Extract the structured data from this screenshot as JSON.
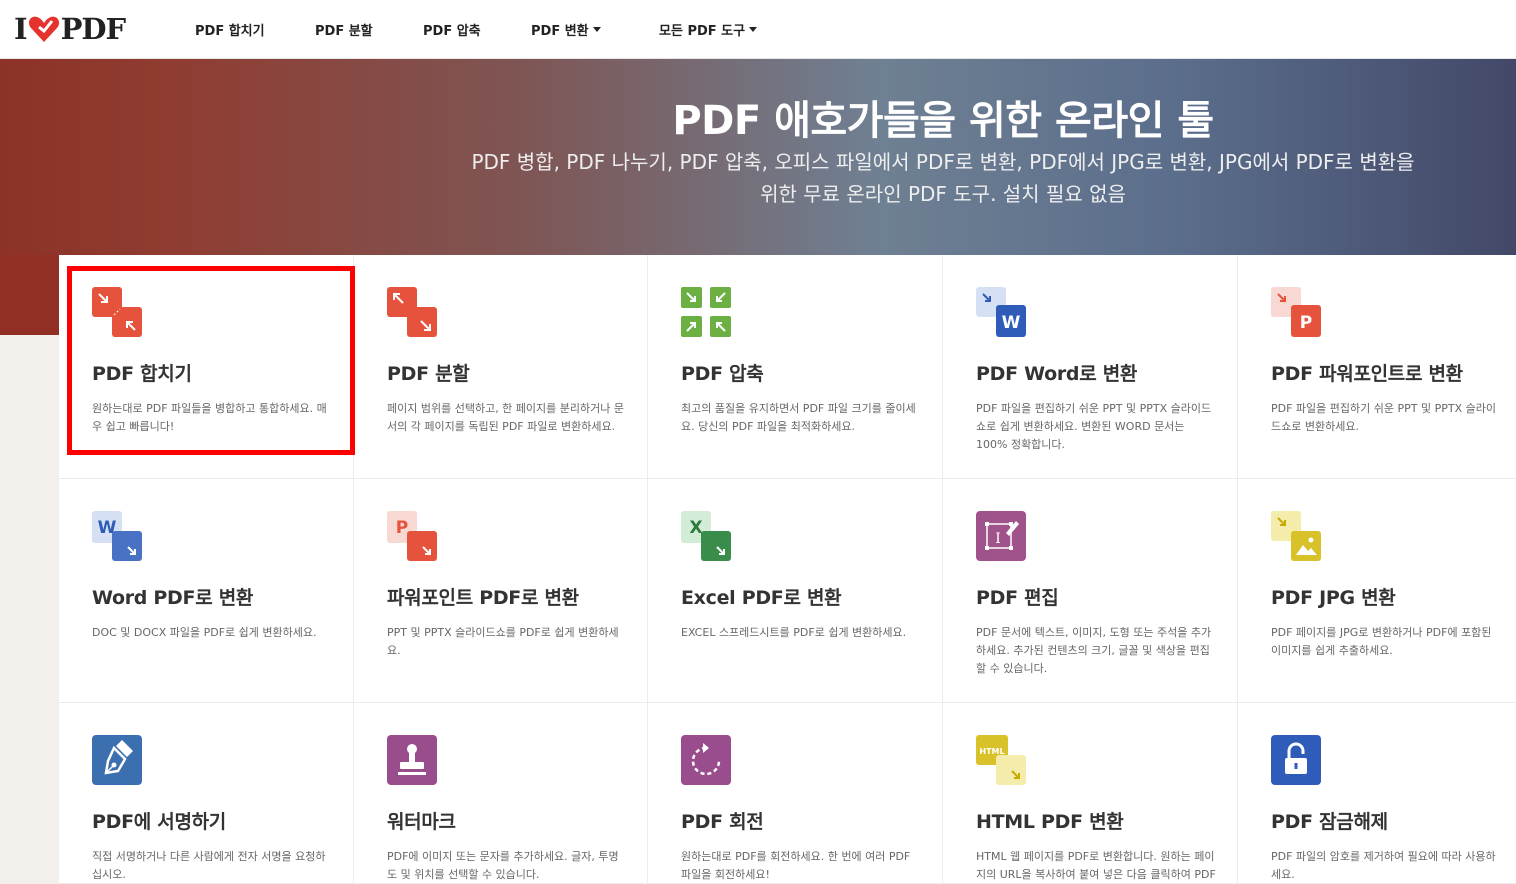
{
  "navbar": {
    "logo_text_left": "I",
    "logo_text_right": "PDF",
    "items": [
      {
        "label": "PDF 합치기",
        "dropdown": false
      },
      {
        "label": "PDF 분할",
        "dropdown": false
      },
      {
        "label": "PDF 압축",
        "dropdown": false
      },
      {
        "label": "PDF 변환",
        "dropdown": true
      },
      {
        "label": "모든 PDF 도구",
        "dropdown": true
      }
    ]
  },
  "hero": {
    "title": "PDF 애호가들을 위한 온라인 툴",
    "subtitle_line1": "PDF 병합, PDF 나누기, PDF 압축, 오피스 파일에서 PDF로 변환, PDF에서 JPG로 변환, JPG에서 PDF로 변환을",
    "subtitle_line2": "위한 무료 온라인 PDF 도구. 설치 필요 없음"
  },
  "tools": [
    {
      "title": "PDF 합치기",
      "desc": "원하는대로 PDF 파일들을 병합하고 통합하세요. 매우 쉽고 빠릅니다!",
      "icon": "merge-pdf-icon",
      "color": "#e5533c"
    },
    {
      "title": "PDF 분할",
      "desc": "페이지 범위를 선택하고, 한 페이지를 분리하거나 문서의 각 페이지를 독립된 PDF 파일로 변환하세요.",
      "icon": "split-pdf-icon",
      "color": "#e5533c"
    },
    {
      "title": "PDF 압축",
      "desc": "최고의 품질을 유지하면서 PDF 파일 크기를 줄이세요. 당신의 PDF 파일을 최적화하세요.",
      "icon": "compress-pdf-icon",
      "color": "#6cb044"
    },
    {
      "title": "PDF Word로 변환",
      "desc": "PDF 파일을 편집하기 쉬운 PPT 및 PPTX 슬라이드쇼로 쉽게 변환하세요. 변환된 WORD 문서는 100% 정확합니다.",
      "icon": "pdf-to-word-icon",
      "color": "#2e5cb8"
    },
    {
      "title": "PDF 파워포인트로 변환",
      "desc": "PDF 파일을 편집하기 쉬운 PPT 및 PPTX 슬라이드쇼로 변환하세요.",
      "icon": "pdf-to-powerpoint-icon",
      "color": "#e5533c"
    },
    {
      "title": "Word PDF로 변환",
      "desc": "DOC 및 DOCX 파일을 PDF로 쉽게 변환하세요.",
      "icon": "word-to-pdf-icon",
      "color": "#2e5cb8"
    },
    {
      "title": "파워포인트 PDF로 변환",
      "desc": "PPT 및 PPTX 슬라이드쇼를 PDF로 쉽게 변환하세요.",
      "icon": "powerpoint-to-pdf-icon",
      "color": "#e5533c"
    },
    {
      "title": "Excel PDF로 변환",
      "desc": "EXCEL 스프레드시트를 PDF로 쉽게 변환하세요.",
      "icon": "excel-to-pdf-icon",
      "color": "#3a8c4a"
    },
    {
      "title": "PDF 편집",
      "desc": "PDF 문서에 텍스트, 이미지, 도형 또는 주석을 추가하세요. 추가된 컨텐츠의 크기, 글꼴 및 색상을 편집할 수 있습니다.",
      "icon": "edit-pdf-icon",
      "color": "#a0528a"
    },
    {
      "title": "PDF JPG 변환",
      "desc": "PDF 페이지를 JPG로 변환하거나 PDF에 포함된 이미지를 쉽게 추출하세요.",
      "icon": "pdf-to-jpg-icon",
      "color": "#d9c12a"
    },
    {
      "title": "PDF에 서명하기",
      "desc": "직접 서명하거나 다른 사람에게 전자 서명을 요청하십시오.",
      "icon": "sign-pdf-icon",
      "color": "#3b6fb0"
    },
    {
      "title": "워터마크",
      "desc": "PDF에 이미지 또는 문자를 추가하세요. 글자, 투명도 및 위치를 선택할 수 있습니다.",
      "icon": "watermark-icon",
      "color": "#9a4d8c"
    },
    {
      "title": "PDF 회전",
      "desc": "원하는대로 PDF를 회전하세요. 한 번에 여러 PDF 파일을 회전하세요!",
      "icon": "rotate-pdf-icon",
      "color": "#9a4d8c"
    },
    {
      "title": "HTML PDF 변환",
      "desc": "HTML 웹 페이지를 PDF로 변환합니다. 원하는 페이지의 URL을 복사하여 붙여 넣은 다음 클릭하여 PDF로 변환합니다.",
      "icon": "html-to-pdf-icon",
      "color": "#d9c12a"
    },
    {
      "title": "PDF 잠금해제",
      "desc": "PDF 파일의 암호를 제거하여 필요에 따라 사용하세요.",
      "icon": "unlock-pdf-icon",
      "color": "#2e5cb8"
    }
  ]
}
